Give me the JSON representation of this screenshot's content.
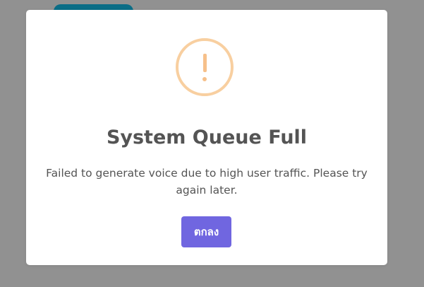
{
  "background": {
    "overlay_color": "#919191",
    "partial_button_color": "#0b6d86"
  },
  "dialog": {
    "icon": "warning-icon",
    "icon_color": "#f8cfa0",
    "title": "System Queue Full",
    "message": "Failed to generate voice due to high user traffic. Please try again later.",
    "confirm_label": "ตกลง",
    "confirm_color": "#7066e0"
  }
}
